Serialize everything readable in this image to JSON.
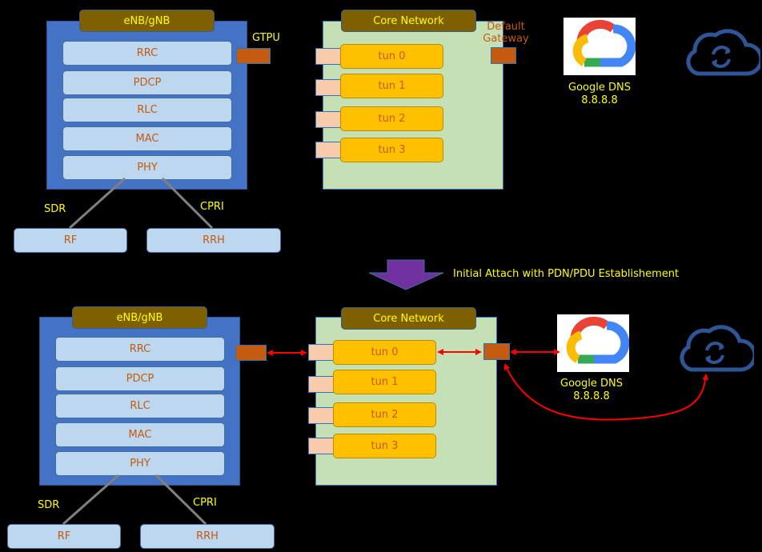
{
  "top": {
    "enb": {
      "title": "eNB/gNB",
      "layers": [
        "RRC",
        "PDCP",
        "RLC",
        "MAC",
        "PHY"
      ],
      "gtpu_label": "GTPU",
      "sdr_label": "SDR",
      "cpri_label": "CPRI",
      "rf_label": "RF",
      "rrh_label": "RRH"
    },
    "core": {
      "title": "Core Network",
      "tunnels": [
        "tun 0",
        "tun 1",
        "tun 2",
        "tun 3"
      ],
      "gateway_label": "Default Gateway"
    },
    "dns": {
      "name": "Google DNS",
      "ip": "8.8.8.8"
    }
  },
  "transition": {
    "label": "Initial Attach with PDN/PDU Establishement"
  },
  "bottom": {
    "enb": {
      "title": "eNB/gNB",
      "layers": [
        "RRC",
        "PDCP",
        "RLC",
        "MAC",
        "PHY"
      ],
      "sdr_label": "SDR",
      "cpri_label": "CPRI",
      "rf_label": "RF",
      "rrh_label": "RRH"
    },
    "core": {
      "title": "Core Network",
      "tunnels": [
        "tun 0",
        "tun 1",
        "tun 2",
        "tun 3"
      ]
    },
    "dns": {
      "name": "Google DNS",
      "ip": "8.8.8.8"
    }
  },
  "colors": {
    "background": "#000000",
    "enb_body": "#4472c4",
    "title_tab": "#7f6000",
    "layer": "#bdd7ee",
    "layer_text": "#c55a11",
    "core_body": "#c5e0b4",
    "tunnel": "#ffc000",
    "gateway_port": "#c55a11",
    "tunnel_port": "#f8cbad",
    "label_yellow": "#ffff00",
    "arrow_red": "#ff0000",
    "transition_arrow": "#7030a0",
    "cloud_icon": "#2f5597"
  }
}
